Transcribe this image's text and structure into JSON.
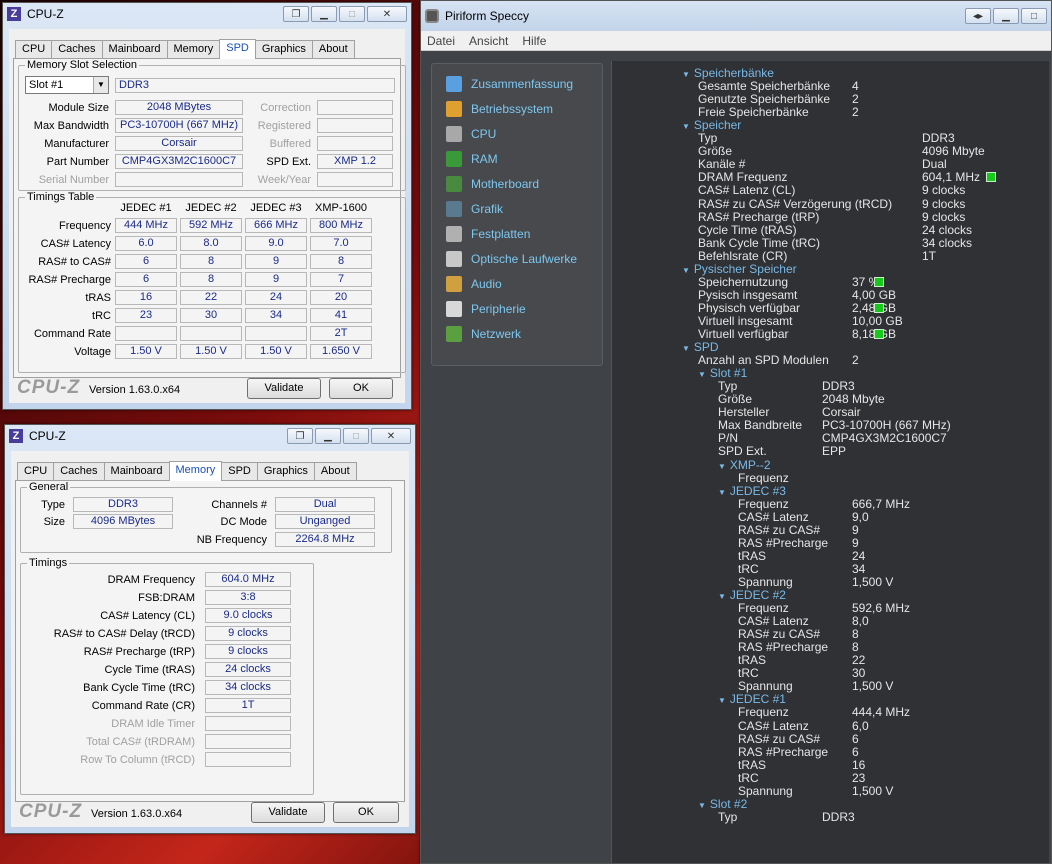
{
  "cpuz_spd": {
    "title": "CPU-Z",
    "tabs": [
      "CPU",
      "Caches",
      "Mainboard",
      "Memory",
      "SPD",
      "Graphics",
      "About"
    ],
    "active_tab": "SPD",
    "slot_group": "Memory Slot Selection",
    "slot_select": "Slot #1",
    "mem_type": "DDR3",
    "left_labels": [
      "Module Size",
      "Max Bandwidth",
      "Manufacturer",
      "Part Number",
      "Serial Number"
    ],
    "left_values": [
      "2048 MBytes",
      "PC3-10700H (667 MHz)",
      "Corsair",
      "CMP4GX3M2C1600C7",
      ""
    ],
    "right_labels": [
      "Correction",
      "Registered",
      "Buffered",
      "SPD Ext.",
      "Week/Year"
    ],
    "right_values": [
      "",
      "",
      "",
      "XMP 1.2",
      ""
    ],
    "timings_group": "Timings Table",
    "col_headers": [
      "JEDEC #1",
      "JEDEC #2",
      "JEDEC #3",
      "XMP-1600"
    ],
    "timing_rows": [
      {
        "label": "Frequency",
        "values": [
          "444 MHz",
          "592 MHz",
          "666 MHz",
          "800 MHz"
        ]
      },
      {
        "label": "CAS# Latency",
        "values": [
          "6.0",
          "8.0",
          "9.0",
          "7.0"
        ]
      },
      {
        "label": "RAS# to CAS#",
        "values": [
          "6",
          "8",
          "9",
          "8"
        ]
      },
      {
        "label": "RAS# Precharge",
        "values": [
          "6",
          "8",
          "9",
          "7"
        ]
      },
      {
        "label": "tRAS",
        "values": [
          "16",
          "22",
          "24",
          "20"
        ]
      },
      {
        "label": "tRC",
        "values": [
          "23",
          "30",
          "34",
          "41"
        ]
      },
      {
        "label": "Command Rate",
        "values": [
          "",
          "",
          "",
          "2T"
        ]
      },
      {
        "label": "Voltage",
        "values": [
          "1.50 V",
          "1.50 V",
          "1.50 V",
          "1.650 V"
        ]
      }
    ],
    "logo": "CPU-Z",
    "version": "Version 1.63.0.x64",
    "validate": "Validate",
    "ok": "OK"
  },
  "cpuz_mem": {
    "title": "CPU-Z",
    "tabs": [
      "CPU",
      "Caches",
      "Mainboard",
      "Memory",
      "SPD",
      "Graphics",
      "About"
    ],
    "active_tab": "Memory",
    "general_group": "General",
    "type_label": "Type",
    "type_value": "DDR3",
    "size_label": "Size",
    "size_value": "4096 MBytes",
    "channels_label": "Channels #",
    "channels_value": "Dual",
    "dcmode_label": "DC Mode",
    "dcmode_value": "Unganged",
    "nbfreq_label": "NB Frequency",
    "nbfreq_value": "2264.8 MHz",
    "timings_group": "Timings",
    "timing_rows": [
      {
        "label": "DRAM Frequency",
        "value": "604.0 MHz"
      },
      {
        "label": "FSB:DRAM",
        "value": "3:8"
      },
      {
        "label": "CAS# Latency (CL)",
        "value": "9.0 clocks"
      },
      {
        "label": "RAS# to CAS# Delay (tRCD)",
        "value": "9 clocks"
      },
      {
        "label": "RAS# Precharge (tRP)",
        "value": "9 clocks"
      },
      {
        "label": "Cycle Time (tRAS)",
        "value": "24 clocks"
      },
      {
        "label": "Bank Cycle Time (tRC)",
        "value": "34 clocks"
      },
      {
        "label": "Command Rate (CR)",
        "value": "1T"
      },
      {
        "label": "DRAM Idle Timer",
        "value": ""
      },
      {
        "label": "Total CAS# (tRDRAM)",
        "value": ""
      },
      {
        "label": "Row To Column (tRCD)",
        "value": ""
      }
    ],
    "logo": "CPU-Z",
    "version": "Version 1.63.0.x64",
    "validate": "Validate",
    "ok": "OK"
  },
  "speccy": {
    "title": "Piriform Speccy",
    "menu": [
      "Datei",
      "Ansicht",
      "Hilfe"
    ],
    "nav": [
      {
        "label": "Zusammenfassung",
        "icon": "summary-icon",
        "color": "#5aa0e0"
      },
      {
        "label": "Betriebssystem",
        "icon": "windows-icon",
        "color": "#e0a030"
      },
      {
        "label": "CPU",
        "icon": "cpu-icon",
        "color": "#a8a8a8"
      },
      {
        "label": "RAM",
        "icon": "ram-icon",
        "color": "#3a9a3a"
      },
      {
        "label": "Motherboard",
        "icon": "motherboard-icon",
        "color": "#4a8a40"
      },
      {
        "label": "Grafik",
        "icon": "monitor-icon",
        "color": "#5a7a90"
      },
      {
        "label": "Festplatten",
        "icon": "harddisk-icon",
        "color": "#b0b0b0"
      },
      {
        "label": "Optische Laufwerke",
        "icon": "optical-drive-icon",
        "color": "#c8c8c8"
      },
      {
        "label": "Audio",
        "icon": "audio-icon",
        "color": "#d0a040"
      },
      {
        "label": "Peripherie",
        "icon": "mouse-icon",
        "color": "#d8d8d8"
      },
      {
        "label": "Netzwerk",
        "icon": "network-icon",
        "color": "#5aa040"
      }
    ],
    "tree": [
      {
        "h": 1,
        "l": 0,
        "t": "Speicherbänke"
      },
      {
        "l": 1,
        "t": "Gesamte Speicherbänke",
        "v": "4",
        "vc": 0
      },
      {
        "l": 1,
        "t": "Genutzte Speicherbänke",
        "v": "2",
        "vc": 0
      },
      {
        "l": 1,
        "t": "Freie Speicherbänke",
        "v": "2",
        "vc": 0
      },
      {
        "h": 1,
        "l": 0,
        "t": "Speicher"
      },
      {
        "l": 1,
        "t": "Typ",
        "v": "DDR3",
        "vc": 1
      },
      {
        "l": 1,
        "t": "Größe",
        "v": "4096 Mbyte",
        "vc": 1
      },
      {
        "l": 1,
        "t": "Kanäle #",
        "v": "Dual",
        "vc": 1
      },
      {
        "l": 1,
        "t": "DRAM Frequenz",
        "v": "604,1 MHz",
        "vc": 1,
        "ind": 1
      },
      {
        "l": 1,
        "t": "CAS# Latenz (CL)",
        "v": "9 clocks",
        "vc": 1
      },
      {
        "l": 1,
        "t": "RAS# zu CAS# Verzögerung (tRCD)",
        "v": "9 clocks",
        "vc": 1
      },
      {
        "l": 1,
        "t": "RAS# Precharge (tRP)",
        "v": "9 clocks",
        "vc": 1
      },
      {
        "l": 1,
        "t": "Cycle Time (tRAS)",
        "v": "24 clocks",
        "vc": 1
      },
      {
        "l": 1,
        "t": "Bank Cycle Time (tRC)",
        "v": "34 clocks",
        "vc": 1
      },
      {
        "l": 1,
        "t": "Befehlsrate (CR)",
        "v": "1T",
        "vc": 1
      },
      {
        "h": 1,
        "l": 0,
        "t": "Pysischer Speicher"
      },
      {
        "l": 1,
        "t": "Speichernutzung",
        "v": "37 %",
        "vc": 2,
        "ind": 1
      },
      {
        "l": 1,
        "t": "Pysisch insgesamt",
        "v": "4,00 GB",
        "vc": 2
      },
      {
        "l": 1,
        "t": "Physisch verfügbar",
        "v": "2,48 GB",
        "vc": 2,
        "ind": 1
      },
      {
        "l": 1,
        "t": "Virtuell insgesamt",
        "v": "10,00 GB",
        "vc": 2
      },
      {
        "l": 1,
        "t": "Virtuell verfügbar",
        "v": "8,18 GB",
        "vc": 2,
        "ind": 1
      },
      {
        "h": 1,
        "l": 0,
        "t": "SPD"
      },
      {
        "l": 1,
        "t": "Anzahl an SPD Modulen",
        "v": "2",
        "vc": 3
      },
      {
        "h": 1,
        "l": 1,
        "t": "Slot #1"
      },
      {
        "l": 2,
        "t": "Typ",
        "v": "DDR3",
        "vc": 4
      },
      {
        "l": 2,
        "t": "Größe",
        "v": "2048 Mbyte",
        "vc": 4
      },
      {
        "l": 2,
        "t": "Hersteller",
        "v": "Corsair",
        "vc": 4
      },
      {
        "l": 2,
        "t": "Max Bandbreite",
        "v": "PC3-10700H (667 MHz)",
        "vc": 4
      },
      {
        "l": 2,
        "t": "P/N",
        "v": "CMP4GX3M2C1600C7",
        "vc": 4
      },
      {
        "l": 2,
        "t": "SPD Ext.",
        "v": "EPP",
        "vc": 4
      },
      {
        "h": 1,
        "l": 2,
        "t": "XMP--2"
      },
      {
        "l": 3,
        "t": "Frequenz"
      },
      {
        "h": 1,
        "l": 2,
        "t": "JEDEC #3"
      },
      {
        "l": 3,
        "t": "Frequenz",
        "v": "666,7 MHz",
        "vc": 5
      },
      {
        "l": 3,
        "t": "CAS# Latenz",
        "v": "9,0",
        "vc": 5
      },
      {
        "l": 3,
        "t": "RAS# zu CAS#",
        "v": "9",
        "vc": 5
      },
      {
        "l": 3,
        "t": "RAS #Precharge",
        "v": "9",
        "vc": 5
      },
      {
        "l": 3,
        "t": "tRAS",
        "v": "24",
        "vc": 5
      },
      {
        "l": 3,
        "t": "tRC",
        "v": "34",
        "vc": 5
      },
      {
        "l": 3,
        "t": "Spannung",
        "v": "1,500 V",
        "vc": 5
      },
      {
        "h": 1,
        "l": 2,
        "t": "JEDEC #2"
      },
      {
        "l": 3,
        "t": "Frequenz",
        "v": "592,6 MHz",
        "vc": 5
      },
      {
        "l": 3,
        "t": "CAS# Latenz",
        "v": "8,0",
        "vc": 5
      },
      {
        "l": 3,
        "t": "RAS# zu CAS#",
        "v": "8",
        "vc": 5
      },
      {
        "l": 3,
        "t": "RAS #Precharge",
        "v": "8",
        "vc": 5
      },
      {
        "l": 3,
        "t": "tRAS",
        "v": "22",
        "vc": 5
      },
      {
        "l": 3,
        "t": "tRC",
        "v": "30",
        "vc": 5
      },
      {
        "l": 3,
        "t": "Spannung",
        "v": "1,500 V",
        "vc": 5
      },
      {
        "h": 1,
        "l": 2,
        "t": "JEDEC #1"
      },
      {
        "l": 3,
        "t": "Frequenz",
        "v": "444,4 MHz",
        "vc": 5
      },
      {
        "l": 3,
        "t": "CAS# Latenz",
        "v": "6,0",
        "vc": 5
      },
      {
        "l": 3,
        "t": "RAS# zu CAS#",
        "v": "6",
        "vc": 5
      },
      {
        "l": 3,
        "t": "RAS #Precharge",
        "v": "6",
        "vc": 5
      },
      {
        "l": 3,
        "t": "tRAS",
        "v": "16",
        "vc": 5
      },
      {
        "l": 3,
        "t": "tRC",
        "v": "23",
        "vc": 5
      },
      {
        "l": 3,
        "t": "Spannung",
        "v": "1,500 V",
        "vc": 5
      },
      {
        "h": 1,
        "l": 1,
        "t": "Slot #2"
      },
      {
        "l": 2,
        "t": "Typ",
        "v": "DDR3",
        "vc": 4
      }
    ],
    "indicator_color": "#18c81a"
  }
}
